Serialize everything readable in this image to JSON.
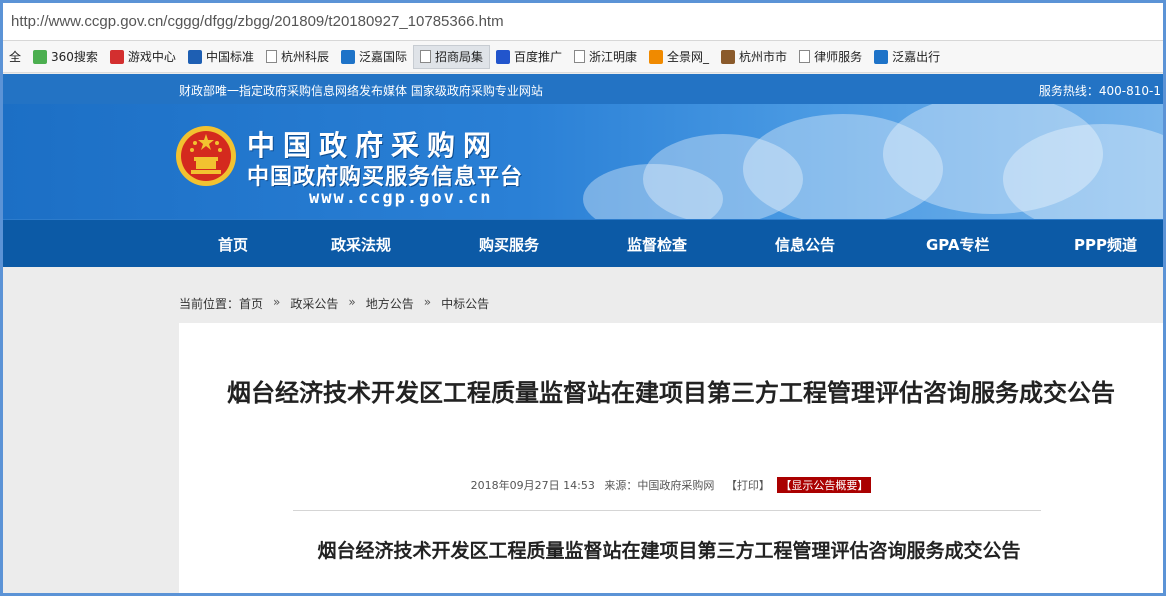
{
  "browser": {
    "url": "http://www.ccgp.gov.cn/cggg/dfgg/zbgg/201809/t20180927_10785366.htm",
    "bookmarks": [
      {
        "label": "全",
        "icon": "none"
      },
      {
        "label": "360搜索",
        "icon": "circle-icon",
        "color": "#4caf50"
      },
      {
        "label": "游戏中心",
        "icon": "game-icon",
        "color": "#d32f2f"
      },
      {
        "label": "中国标准",
        "icon": "standard-icon",
        "color": "#1e5fb3"
      },
      {
        "label": "杭州科辰",
        "icon": "page-icon"
      },
      {
        "label": "泛嘉国际",
        "icon": "fanjia-icon",
        "color": "#1e73c8"
      },
      {
        "label": "招商局集",
        "icon": "page-icon",
        "active": true
      },
      {
        "label": "百度推广",
        "icon": "paw-icon",
        "color": "#2255cc"
      },
      {
        "label": "浙江明康",
        "icon": "page-icon"
      },
      {
        "label": "全景网_",
        "icon": "quanjing-icon",
        "color": "#f08a00"
      },
      {
        "label": "杭州市市",
        "icon": "city-icon",
        "color": "#8a5a2b"
      },
      {
        "label": "律师服务",
        "icon": "page-icon"
      },
      {
        "label": "泛嘉出行",
        "icon": "fanjia-icon",
        "color": "#1e73c8"
      }
    ]
  },
  "infobar": {
    "left_text": "财政部唯一指定政府采购信息网络发布媒体  国家级政府采购专业网站",
    "right_text": "服务热线：400-810-1"
  },
  "banner": {
    "title": "中国政府采购网",
    "subtitle": "中国政府购买服务信息平台",
    "domain": "www.ccgp.gov.cn"
  },
  "nav": {
    "items": [
      "首页",
      "政采法规",
      "购买服务",
      "监督检查",
      "信息公告",
      "GPA专栏",
      "PPP频道"
    ]
  },
  "breadcrumb": {
    "prefix": "当前位置：",
    "items": [
      "首页",
      "政采公告",
      "地方公告",
      "中标公告"
    ],
    "separator": "»"
  },
  "article": {
    "title": "烟台经济技术开发区工程质量监督站在建项目第三方工程管理评估咨询服务成交公告",
    "date": "2018年09月27日  14:53",
    "source_label": "来源：",
    "source": "中国政府采购网",
    "print_label": "【打印】",
    "summary_label": "【显示公告概要】",
    "body_title": "烟台经济技术开发区工程质量监督站在建项目第三方工程管理评估咨询服务成交公告"
  },
  "colors": {
    "infobar": "#2373c4",
    "nav": "#0c5aa6",
    "summary_button": "#aa0000",
    "window_border": "#5b93d6"
  }
}
